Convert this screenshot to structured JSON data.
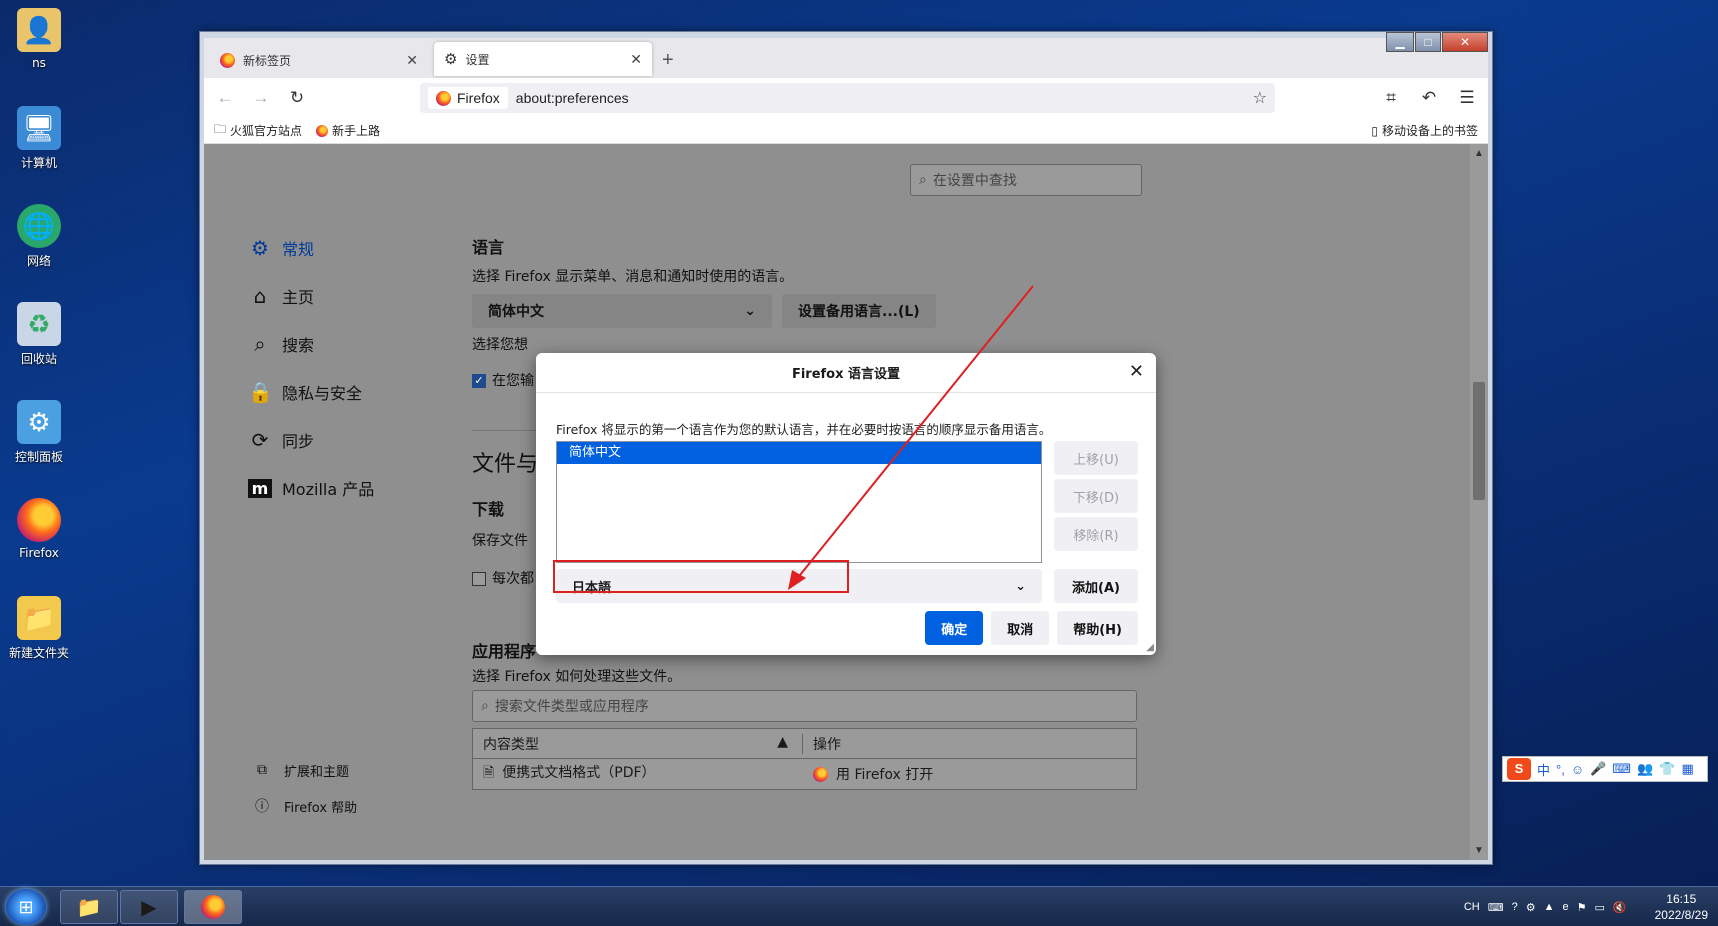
{
  "desktop": {
    "icons": [
      {
        "label": "ns",
        "icon": "user-folder-icon"
      },
      {
        "label": "计算机",
        "icon": "computer-icon"
      },
      {
        "label": "网络",
        "icon": "network-icon"
      },
      {
        "label": "回收站",
        "icon": "recycle-bin-icon"
      },
      {
        "label": "控制面板",
        "icon": "control-panel-icon"
      },
      {
        "label": "Firefox",
        "icon": "firefox-icon"
      },
      {
        "label": "新建文件夹",
        "icon": "folder-icon"
      }
    ]
  },
  "browser": {
    "tabs": [
      {
        "label": "新标签页",
        "active": false
      },
      {
        "label": "设置",
        "active": true
      }
    ],
    "url": {
      "badge": "Firefox",
      "text": "about:preferences"
    },
    "bookmarks": {
      "left": [
        "火狐官方站点",
        "新手上路"
      ],
      "right": "移动设备上的书签"
    }
  },
  "prefs": {
    "search_placeholder": "在设置中查找",
    "sidebar": [
      "常规",
      "主页",
      "搜索",
      "隐私与安全",
      "同步",
      "Mozilla 产品"
    ],
    "sidebar_bottom": [
      "扩展和主题",
      "Firefox 帮助"
    ],
    "language": {
      "heading": "语言",
      "desc": "选择 Firefox 显示菜单、消息和通知时使用的语言。",
      "selected": "简体中文",
      "alt_button": "设置备用语言...(L)",
      "partial_line": "选择您想",
      "checkbox_partial": "在您输"
    },
    "files_heading_partial": "文件与",
    "download": {
      "heading": "下载",
      "save_partial": "保存文件",
      "ask_partial": "每次都"
    },
    "apps": {
      "heading": "应用程序",
      "desc": "选择 Firefox 如何处理这些文件。",
      "search_placeholder": "搜索文件类型或应用程序",
      "col_type": "内容类型",
      "col_action": "操作",
      "rows": [
        {
          "type": "便携式文档格式（PDF）",
          "action": "用 Firefox 打开"
        }
      ]
    }
  },
  "dialog": {
    "title": "Firefox 语言设置",
    "desc": "Firefox 将显示的第一个语言作为您的默认语言，并在必要时按语言的顺序显示备用语言。",
    "languages": [
      "简体中文"
    ],
    "move_up": "上移(U)",
    "move_down": "下移(D)",
    "remove": "移除(R)",
    "add_select": "日本語",
    "add_button": "添加(A)",
    "ok": "确定",
    "cancel": "取消",
    "help": "帮助(H)"
  },
  "ime": {
    "logo": "S",
    "mode": "中"
  },
  "taskbar": {
    "tray_lang": "CH",
    "time": "16:15",
    "date": "2022/8/29"
  },
  "colors": {
    "accent": "#0061e0",
    "annotation": "#e02020"
  }
}
